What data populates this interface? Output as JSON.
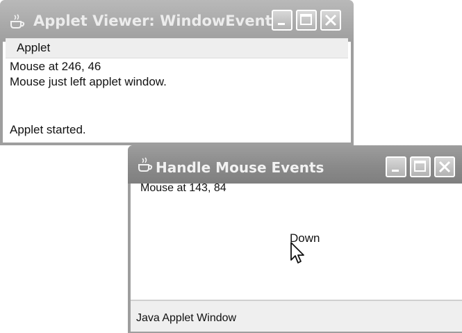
{
  "applet_viewer": {
    "title": "Applet Viewer: WindowEvents",
    "menu": [
      "Applet"
    ],
    "lines": [
      "Mouse at 246, 46",
      "Mouse just left applet window."
    ],
    "status": "Applet started."
  },
  "mouse_window": {
    "title": "Handle Mouse Events",
    "coords_text": "Mouse at 143, 84",
    "event_text": "Down",
    "status": "Java Applet Window"
  },
  "icons": [
    "java-cup-icon",
    "minimize-icon",
    "maximize-icon",
    "close-icon",
    "mouse-cursor-icon"
  ]
}
